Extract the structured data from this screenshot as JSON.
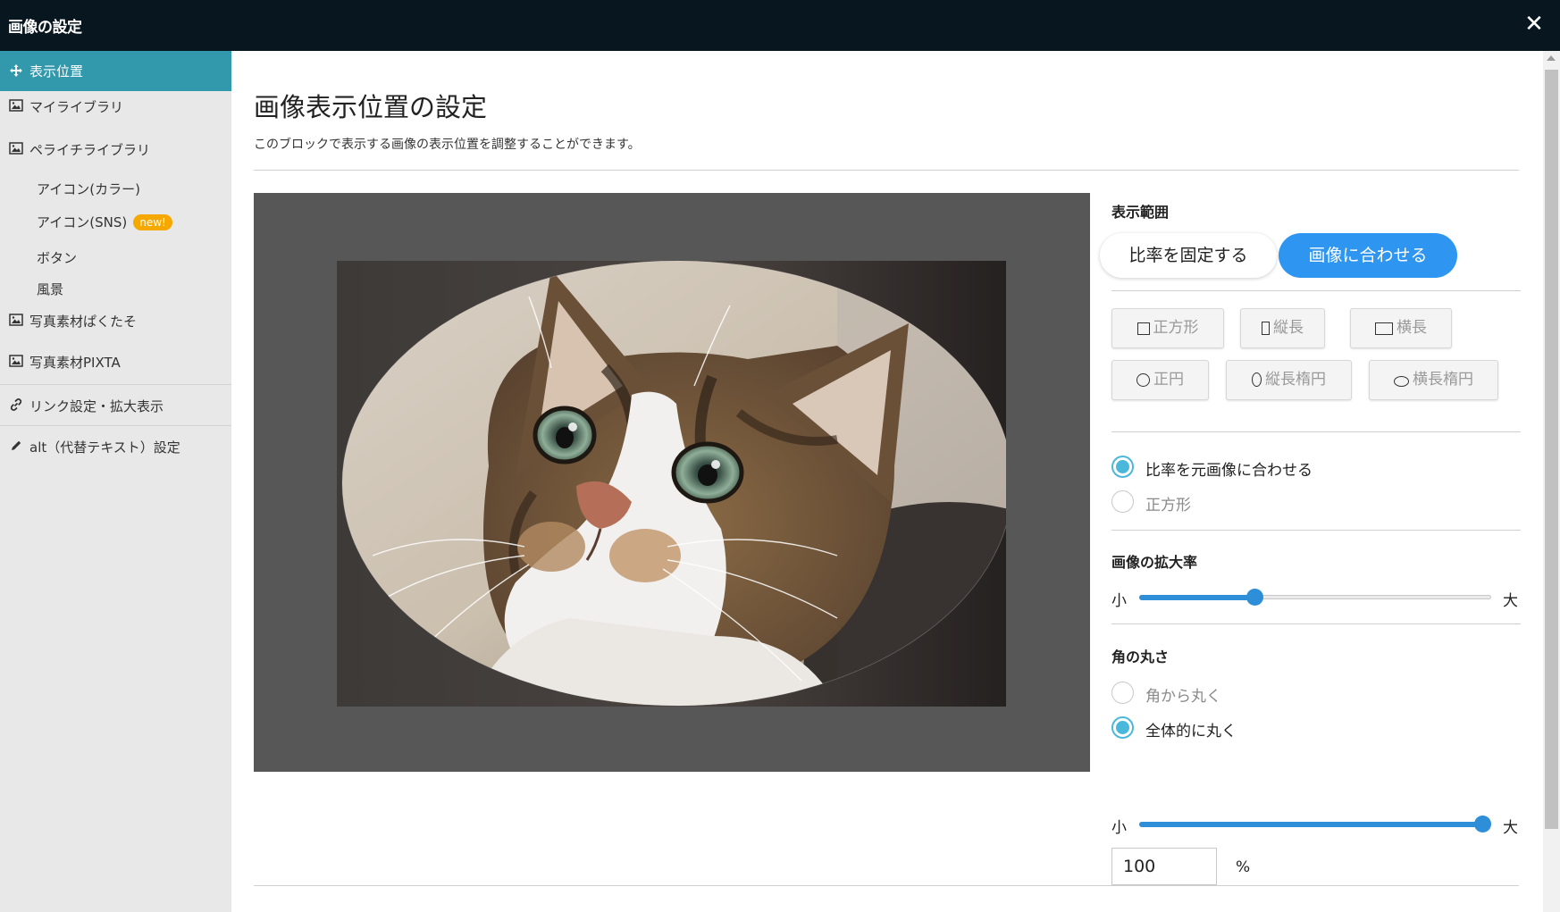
{
  "window": {
    "title": "画像の設定",
    "close_label": "✕"
  },
  "sidebar": {
    "items": [
      {
        "label": "表示位置",
        "icon": "move-icon",
        "active": true
      },
      {
        "label": "マイライブラリ",
        "icon": "image-icon"
      },
      {
        "label": "ペライチライブラリ",
        "icon": "image-icon"
      },
      {
        "label": "写真素材ぱくたそ",
        "icon": "image-icon"
      },
      {
        "label": "写真素材PIXTA",
        "icon": "image-icon"
      },
      {
        "label": "リンク設定・拡大表示",
        "icon": "link-icon"
      },
      {
        "label": "alt（代替テキスト）設定",
        "icon": "pencil-icon"
      }
    ],
    "subitems": [
      {
        "label": "アイコン(カラー)"
      },
      {
        "label": "アイコン(SNS)",
        "badge": "new!"
      },
      {
        "label": "ボタン"
      },
      {
        "label": "風景"
      }
    ]
  },
  "main": {
    "title": "画像表示位置の設定",
    "description": "このブロックで表示する画像の表示位置を調整することができます。"
  },
  "panel": {
    "display_range": {
      "label": "表示範囲",
      "fixed_ratio": "比率を固定する",
      "fit_image": "画像に合わせる"
    },
    "shapes": {
      "square": "正方形",
      "portrait": "縦長",
      "landscape": "横長",
      "circle": "正円",
      "tall_ellipse": "縦長楕円",
      "wide_ellipse": "横長楕円"
    },
    "ratio_options": {
      "original": "比率を元画像に合わせる",
      "square": "正方形",
      "selected": "original"
    },
    "zoom": {
      "label": "画像の拡大率",
      "min_label": "小",
      "max_label": "大",
      "value": 0.32
    },
    "corner": {
      "label": "角の丸さ",
      "from_corners": "角から丸く",
      "whole": "全体的に丸く",
      "selected": "whole",
      "min_label": "小",
      "max_label": "大",
      "value": 100,
      "unit": "%"
    }
  },
  "colors": {
    "titlebar": "#08171f",
    "active_nav": "#3298ab",
    "primary": "#2e95f0",
    "radio": "#4ab8da",
    "badge": "#f5a800"
  }
}
